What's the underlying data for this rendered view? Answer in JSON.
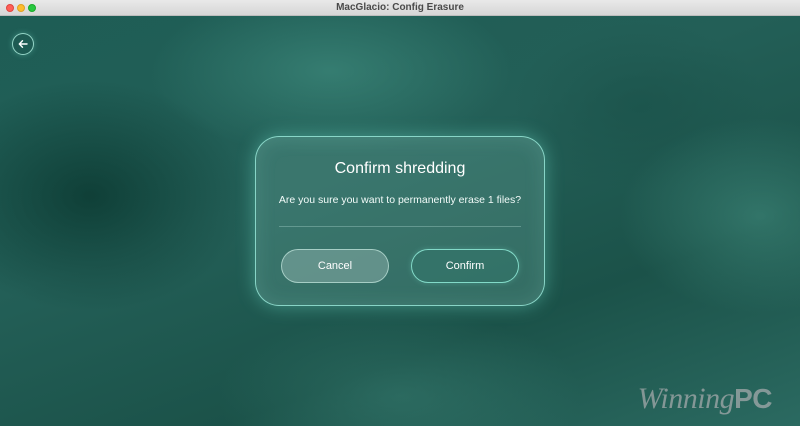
{
  "window": {
    "title": "MacGlacio: Config Erasure"
  },
  "nav": {
    "back_icon": "arrow-left-icon"
  },
  "dialog": {
    "title": "Confirm shredding",
    "message": "Are you sure you want to permanently erase 1 files?",
    "cancel_label": "Cancel",
    "confirm_label": "Confirm"
  },
  "watermark": {
    "part1": "Winning",
    "part2": "PC"
  },
  "colors": {
    "background": "#1f5a52",
    "accent_border": "#96e6d7",
    "text": "#ffffff"
  }
}
